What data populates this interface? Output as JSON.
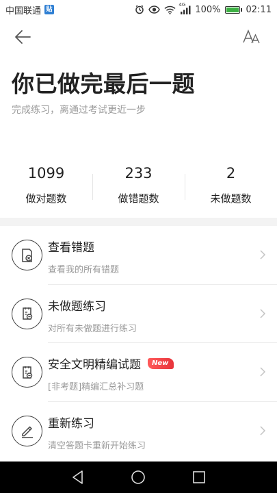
{
  "status_bar": {
    "carrier": "中国联通",
    "app_badge": "贴",
    "network": "4G",
    "battery": "100%",
    "battery_level": 1.0,
    "time": "02:11",
    "icons": [
      "alarm-icon",
      "eye-icon",
      "wifi-icon",
      "signal-icon",
      "battery-icon"
    ]
  },
  "header": {
    "back_icon": "arrow-left-icon",
    "font_icon": "font-size-icon"
  },
  "result": {
    "title": "你已做完最后一题",
    "subtitle": "完成练习，离通过考试更近一步"
  },
  "stats": [
    {
      "value": "1099",
      "label": "做对题数"
    },
    {
      "value": "233",
      "label": "做错题数"
    },
    {
      "value": "2",
      "label": "未做题数"
    }
  ],
  "menu": [
    {
      "title": "查看错题",
      "desc": "查看我的所有错题",
      "icon": "wrong-questions-icon",
      "badge": ""
    },
    {
      "title": "未做题练习",
      "desc": "对所有未做题进行练习",
      "icon": "clipboard-minus-icon",
      "badge": ""
    },
    {
      "title": "安全文明精编试题",
      "desc": "[非考题]精编汇总补习题",
      "icon": "clipboard-minus-icon",
      "badge": "New"
    },
    {
      "title": "重新练习",
      "desc": "清空答题卡重新开始练习",
      "icon": "pencil-icon",
      "badge": ""
    }
  ],
  "colors": {
    "accent_badge": "#e8343b",
    "battery_fill": "#3cb043",
    "muted_text": "#9a9a9a"
  }
}
